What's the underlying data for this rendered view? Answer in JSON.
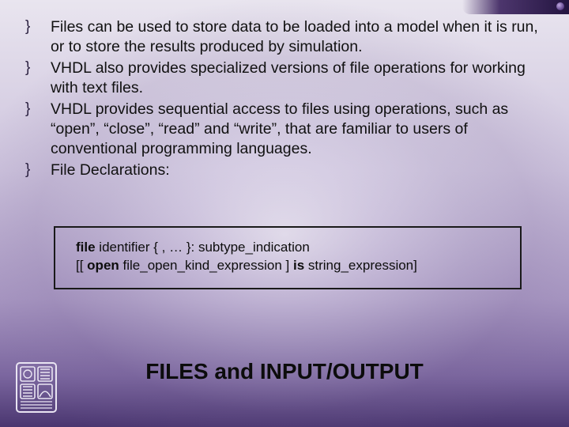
{
  "bullets": [
    "Files can be used to store data to be loaded into a model when it is run, or to store the results produced by simulation.",
    "VHDL also provides specialized versions of file operations for working with text files.",
    "VHDL provides sequential access to files using operations, such as “open”, “close”, “read” and “write”, that are familiar to users of conventional programming languages.",
    "File Declarations:"
  ],
  "syntax": {
    "kw_file": "file",
    "seg1": " identifier { , … }: subtype_indication",
    "seg2a": "[[ ",
    "kw_open": "open",
    "seg2b": " file_open_kind_expression ] ",
    "kw_is": "is",
    "seg2c": " string_expression]"
  },
  "footer_title": "FILES and INPUT/OUTPUT"
}
